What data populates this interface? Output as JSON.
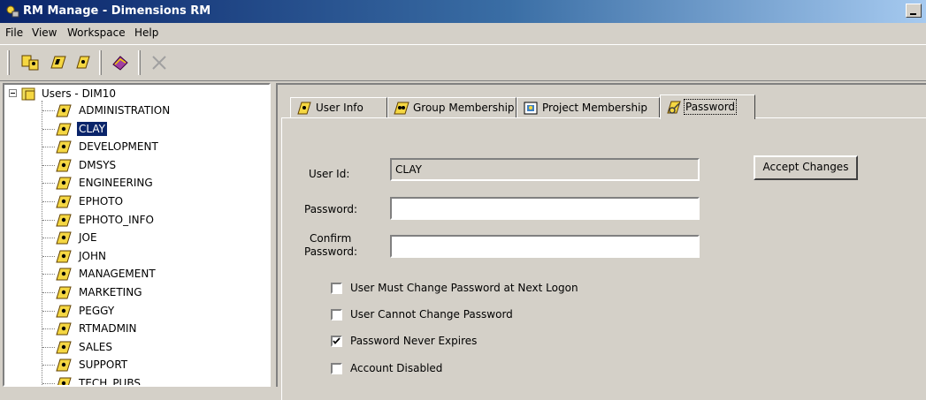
{
  "window": {
    "title": "RM Manage - Dimensions RM"
  },
  "menu": {
    "items": [
      "File",
      "View",
      "Workspace",
      "Help"
    ]
  },
  "tree": {
    "root_label": "Users - DIM10",
    "users": [
      "ADMINISTRATION",
      "CLAY",
      "DEVELOPMENT",
      "DMSYS",
      "ENGINEERING",
      "EPHOTO",
      "EPHOTO_INFO",
      "JOE",
      "JOHN",
      "MANAGEMENT",
      "MARKETING",
      "PEGGY",
      "RTMADMIN",
      "SALES",
      "SUPPORT",
      "TECH_PUBS"
    ],
    "selected": "CLAY"
  },
  "tabs": [
    {
      "label": "User Info",
      "icon": "user-icon"
    },
    {
      "label": "Group Membership",
      "icon": "group-icon"
    },
    {
      "label": "Project Membership",
      "icon": "project-icon"
    },
    {
      "label": "Password",
      "icon": "password-icon",
      "active": true
    }
  ],
  "form": {
    "user_id_label": "User Id:",
    "user_id_value": "CLAY",
    "password_label": "Password:",
    "password_value": "",
    "confirm_label_line1": "Confirm",
    "confirm_label_line2": "Password:",
    "confirm_value": "",
    "accept_button": "Accept Changes",
    "checkboxes": [
      {
        "label": "User Must Change Password at Next Logon",
        "checked": false
      },
      {
        "label": "User Cannot Change Password",
        "checked": false
      },
      {
        "label": "Password Never Expires",
        "checked": true
      },
      {
        "label": "Account Disabled",
        "checked": false
      }
    ]
  },
  "colors": {
    "face": "#d4d0c8",
    "selection": "#0a246a",
    "title_start": "#0a246a",
    "title_end": "#a6caf0"
  }
}
